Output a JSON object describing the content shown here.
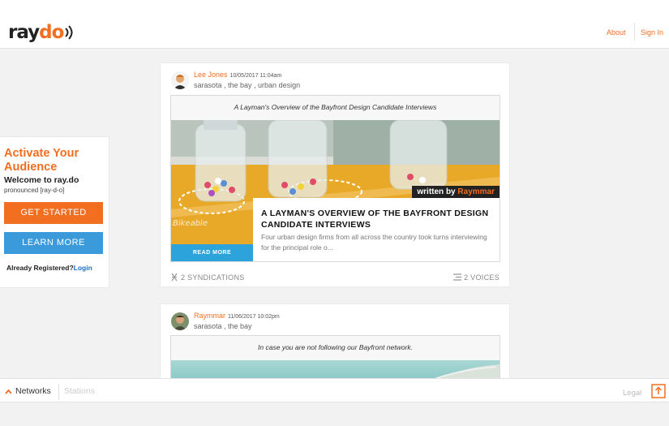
{
  "header": {
    "logo_text_ray": "ray",
    "logo_text_o": "do",
    "about": "About",
    "sign_in": "Sign In"
  },
  "cta": {
    "headline": "Activate Your Audience",
    "welcome": "Welcome to ray.do",
    "pronounced": "pronounced [ray-d-o]",
    "get_started": "GET STARTED",
    "learn_more": "LEARN MORE",
    "already": "Already Registered?",
    "login": "Login"
  },
  "posts": [
    {
      "author": "Lee Jones",
      "timestamp": "10/05/2017 11:04am",
      "tags": "sarasota , the bay , urban design",
      "caption": "A Layman's Overview of the Bayfront Design Candidate Interviews",
      "written_by_prefix": "written by",
      "written_by_name": "Raymmar",
      "article_title": "A LAYMAN'S OVERVIEW OF THE BAYFRONT DESIGN CANDIDATE INTERVIEWS",
      "article_desc": "Four urban design firms from all across the country took turns interviewing for the principal role o...",
      "read_more": "READ MORE",
      "syndications": "2 SYNDICATIONS",
      "voices": "2 VOICES"
    },
    {
      "author": "Raymmar",
      "timestamp": "11/06/2017 10:02pm",
      "tags": "sarasota , the bay",
      "caption": "In case you are not following our Bayfront network."
    }
  ],
  "bottom": {
    "networks": "Networks",
    "stations": "Stations",
    "legal": "Legal"
  },
  "colors": {
    "accent": "#f26f21",
    "blue": "#3b9ad9",
    "readmore_blue": "#2da3dc"
  }
}
